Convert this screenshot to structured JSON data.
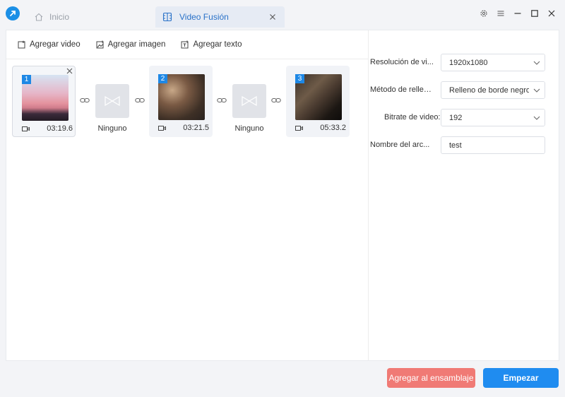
{
  "titlebar": {
    "tabs": [
      {
        "label": "Inicio",
        "active": false
      },
      {
        "label": "Video Fusión",
        "active": true
      }
    ]
  },
  "toolbar": {
    "add_video": "Agregar video",
    "add_image": "Agregar imagen",
    "add_text": "Agregar texto"
  },
  "clips": [
    {
      "index": "1",
      "duration": "03:19.6"
    },
    {
      "index": "2",
      "duration": "03:21.5"
    },
    {
      "index": "3",
      "duration": "05:33.2"
    }
  ],
  "transitions": [
    {
      "label": "Ninguno"
    },
    {
      "label": "Ninguno"
    }
  ],
  "settings": {
    "resolution": {
      "label": "Resolución de vi...",
      "value": "1920x1080"
    },
    "fill_method": {
      "label": "Método de relleno:",
      "value": "Relleno de borde negro"
    },
    "bitrate": {
      "label": "Bitrate de video:",
      "value": "192"
    },
    "file_name": {
      "label": "Nombre del arc...",
      "value": "test"
    }
  },
  "footer": {
    "add_to_queue": "Agregar al ensamblaje",
    "start": "Empezar"
  },
  "colors": {
    "accent": "#1f8cf0",
    "secondary": "#f07a75",
    "badge": "#1e88e5"
  },
  "icons": [
    "app-logo-icon",
    "home-icon",
    "merge-icon",
    "close-icon",
    "settings-icon",
    "menu-icon",
    "minimize-icon",
    "maximize-icon",
    "add-video-icon",
    "add-image-icon",
    "add-text-icon",
    "link-icon",
    "transition-icon",
    "video-camera-icon",
    "chevron-down-icon"
  ]
}
